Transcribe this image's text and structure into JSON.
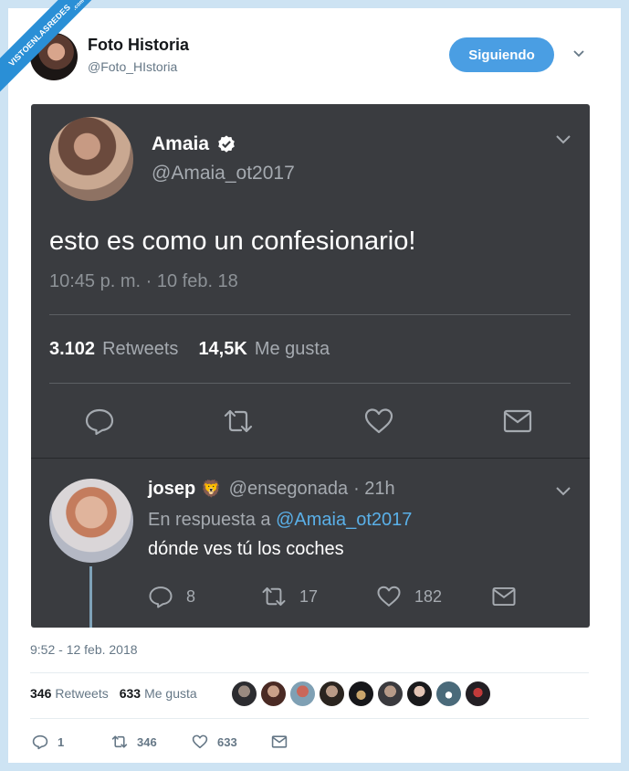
{
  "watermark": {
    "text": "VISTOENLASREDES",
    "sub": ".com"
  },
  "author": {
    "name": "Foto Historia",
    "handle": "@Foto_HIstoria",
    "follow_label": "Siguiendo"
  },
  "quoted": {
    "name": "Amaia",
    "handle": "@Amaia_ot2017",
    "text": "esto es como un confesionario!",
    "time": "10:45 p. m. · 10 feb. 18",
    "retweets_count": "3.102",
    "retweets_label": "Retweets",
    "likes_count": "14,5K",
    "likes_label": "Me gusta"
  },
  "reply": {
    "name": "josep",
    "emoji": "🦁",
    "handle": "@ensegonada",
    "age": "· 21h",
    "reply_prefix": "En respuesta a",
    "reply_to": "@Amaia_ot2017",
    "text": "dónde ves tú los coches",
    "reply_count": "8",
    "retweet_count": "17",
    "like_count": "182"
  },
  "main": {
    "timestamp": "9:52 - 12 feb. 2018",
    "retweets_count": "346",
    "retweets_label": "Retweets",
    "likes_count": "633",
    "likes_label": "Me gusta",
    "reply_count": "1",
    "retweet_count": "346",
    "like_count": "633"
  },
  "colors": {
    "accent": "#4a9ee3",
    "card_bg": "#3a3c40",
    "link": "#5ab0e8",
    "ribbon": "#2a8fd6"
  },
  "icons": [
    "chevron-down-icon",
    "verified-badge-icon",
    "reply-icon",
    "retweet-icon",
    "heart-icon",
    "mail-icon"
  ]
}
